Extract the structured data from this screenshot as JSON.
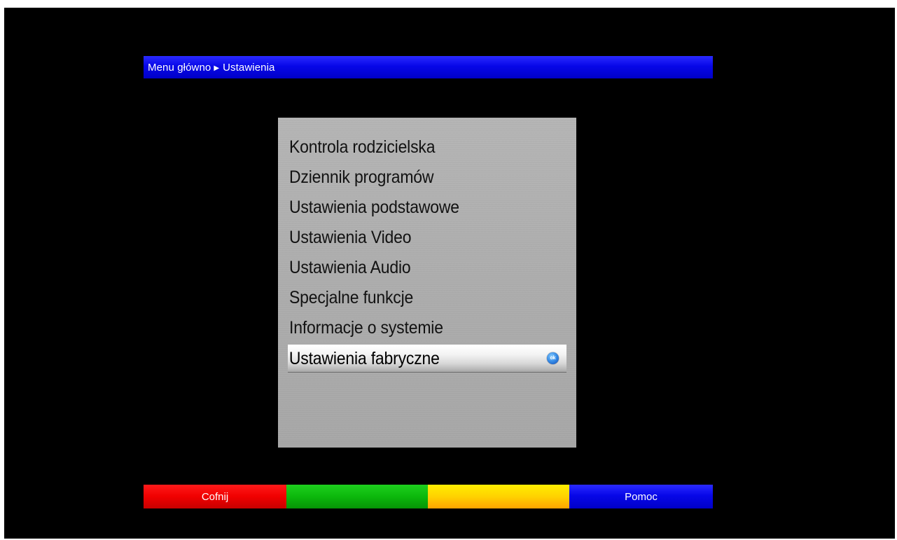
{
  "breadcrumb": {
    "root": "Menu główno",
    "separator": "▶",
    "current": "Ustawienia"
  },
  "menu": {
    "items": [
      {
        "label": "Kontrola rodzicielska"
      },
      {
        "label": "Dziennik programów"
      },
      {
        "label": "Ustawienia podstawowe"
      },
      {
        "label": "Ustawienia Video"
      },
      {
        "label": "Ustawienia Audio"
      },
      {
        "label": "Specjalne funkcje"
      },
      {
        "label": "Informacje o systemie"
      },
      {
        "label": "Ustawienia fabryczne",
        "selected": true,
        "icon": "ok-icon",
        "icon_text": "ok"
      }
    ]
  },
  "buttons": {
    "red": {
      "label": "Cofnij",
      "color": "#f00000"
    },
    "green": {
      "label": "",
      "color": "#0cb80c"
    },
    "yellow": {
      "label": "",
      "color": "#ffd200"
    },
    "blue": {
      "label": "Pomoc",
      "color": "#0707e8"
    }
  }
}
